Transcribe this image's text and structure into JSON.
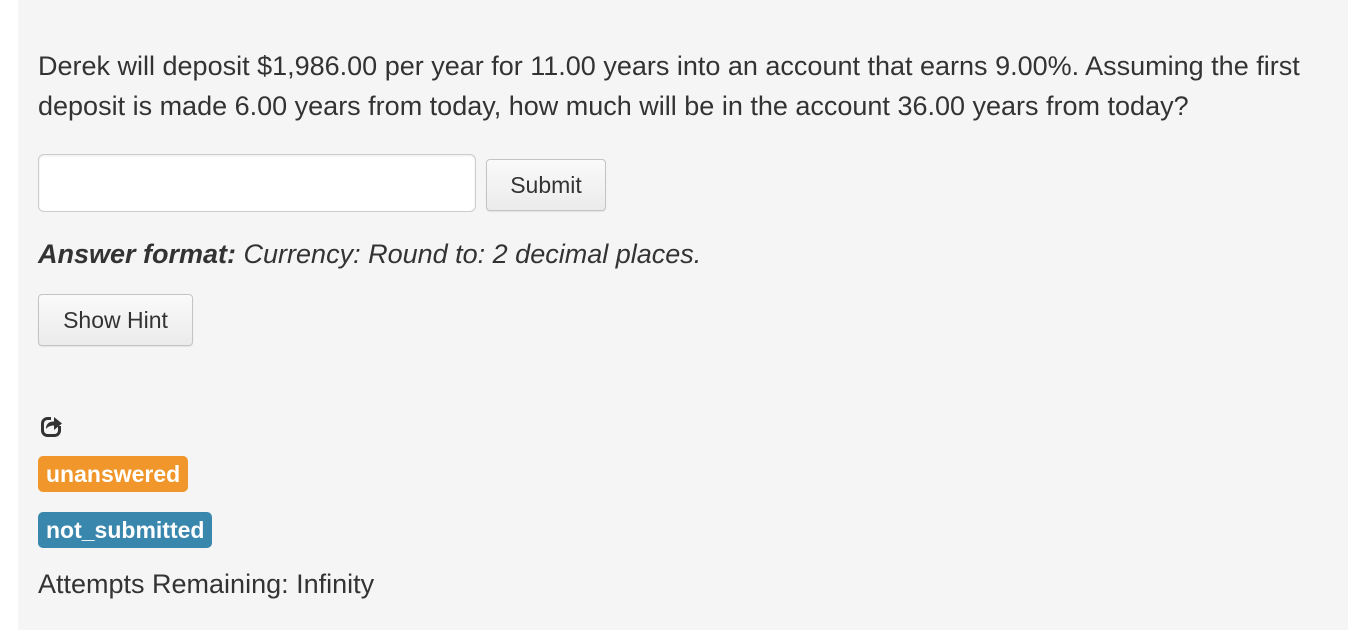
{
  "question": {
    "text": "Derek will deposit $1,986.00 per year for 11.00 years into an account that earns 9.00%. Assuming the first deposit is made 6.00 years from today, how much will be in the account 36.00 years from today?"
  },
  "answer_input": {
    "value": "",
    "placeholder": ""
  },
  "buttons": {
    "submit_label": "Submit",
    "hint_label": "Show Hint"
  },
  "answer_format": {
    "label": "Answer format:",
    "text": "Currency: Round to: 2 decimal places."
  },
  "icons": {
    "share": "share-icon"
  },
  "status": {
    "answered_badge": "unanswered",
    "answered_badge_color": "#f0962a",
    "submitted_badge": "not_submitted",
    "submitted_badge_color": "#3a87ad"
  },
  "attempts": {
    "text": "Attempts Remaining: Infinity"
  },
  "colors": {
    "panel_background": "#f5f5f5",
    "text": "#333333"
  }
}
